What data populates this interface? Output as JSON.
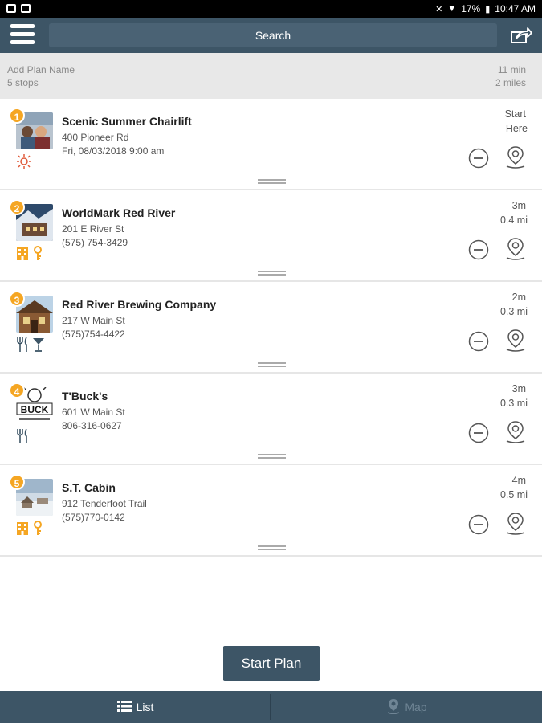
{
  "status_bar": {
    "battery": "17%",
    "time": "10:47 AM"
  },
  "app_bar": {
    "search_label": "Search"
  },
  "plan": {
    "name_placeholder": "Add Plan Name",
    "stops_count": "5 stops",
    "total_time": "11 min",
    "total_distance": "2 miles"
  },
  "stops": [
    {
      "number": "1",
      "name": "Scenic Summer Chairlift",
      "line1": "400 Pioneer Rd",
      "line2": "Fri, 08/03/2018 9:00 am",
      "meta1": "Start",
      "meta2": "Here",
      "amenities": [
        "sun-icon"
      ]
    },
    {
      "number": "2",
      "name": "WorldMark Red River",
      "line1": "201 E River St",
      "line2": "(575) 754-3429",
      "meta1": "3m",
      "meta2": "0.4 mi",
      "amenities": [
        "hotel-icon",
        "key-icon"
      ]
    },
    {
      "number": "3",
      "name": "Red River Brewing Company",
      "line1": "217 W Main St",
      "line2": "(575)754-4422",
      "meta1": "2m",
      "meta2": "0.3 mi",
      "amenities": [
        "restaurant-icon",
        "cocktail-icon"
      ]
    },
    {
      "number": "4",
      "name": "T'Buck's",
      "line1": "601 W Main St",
      "line2": "806-316-0627",
      "meta1": "3m",
      "meta2": "0.3 mi",
      "amenities": [
        "restaurant-icon"
      ]
    },
    {
      "number": "5",
      "name": "S.T. Cabin",
      "line1": "912 Tenderfoot Trail",
      "line2": "(575)770-0142",
      "meta1": "4m",
      "meta2": "0.5 mi",
      "amenities": [
        "hotel-icon",
        "key-icon"
      ]
    }
  ],
  "thumb_text": {
    "tbucks": "BUCK"
  },
  "start_button": "Start Plan",
  "tabs": {
    "list": "List",
    "map": "Map"
  },
  "colors": {
    "header": "#3d5566",
    "badge": "#f5a623",
    "amenity": "#f5a623",
    "dark_amenity": "#3d5566"
  }
}
